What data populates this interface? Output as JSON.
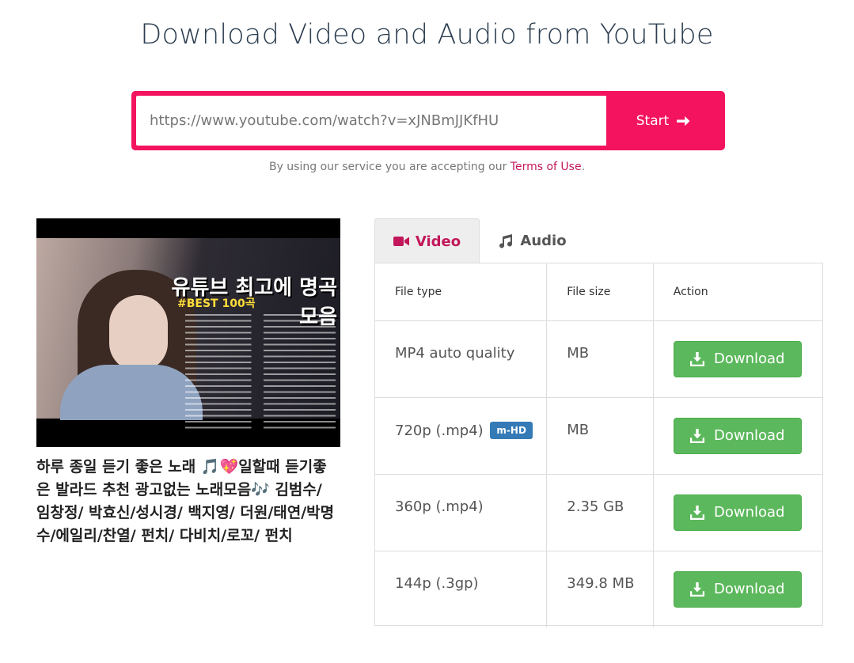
{
  "page": {
    "title": "Download Video and Audio from YouTube"
  },
  "search": {
    "value": "https://www.youtube.com/watch?v=xJNBmJJKfHU",
    "start_label": "Start",
    "brand_color": "#f4135e"
  },
  "terms": {
    "prefix": "By using our service you are accepting our ",
    "link_label": "Terms of Use",
    "suffix": "."
  },
  "video": {
    "thumbnail_headline": "유튜브 최고에 명곡모음",
    "thumbnail_sub": "#BEST 100곡",
    "title": "하루 종일 듣기 좋은 노래 🎵💖일할때 듣기좋은 발라드 추천 광고없는 노래모음🎶 김범수/ 임창정/ 박효신/성시경/ 백지영/ 더원/태연/박명수/에일리/찬열/ 펀치/ 다비치/로꼬/ 펀치"
  },
  "tabs": [
    {
      "label": "Video",
      "icon": "video-camera-icon",
      "active": true
    },
    {
      "label": "Audio",
      "icon": "music-note-icon",
      "active": false
    }
  ],
  "table": {
    "headers": [
      "File type",
      "File size",
      "Action"
    ],
    "rows": [
      {
        "type": "MP4 auto quality",
        "badge": "",
        "size": "MB",
        "action": "Download"
      },
      {
        "type": "720p (.mp4)",
        "badge": "m-HD",
        "size": "MB",
        "action": "Download"
      },
      {
        "type": "360p (.mp4)",
        "badge": "",
        "size": "2.35 GB",
        "action": "Download"
      },
      {
        "type": "144p (.3gp)",
        "badge": "",
        "size": "349.8 MB",
        "action": "Download"
      }
    ]
  },
  "colors": {
    "accent": "#c2185b",
    "download_button": "#5cb85c",
    "badge": "#337ab7"
  }
}
